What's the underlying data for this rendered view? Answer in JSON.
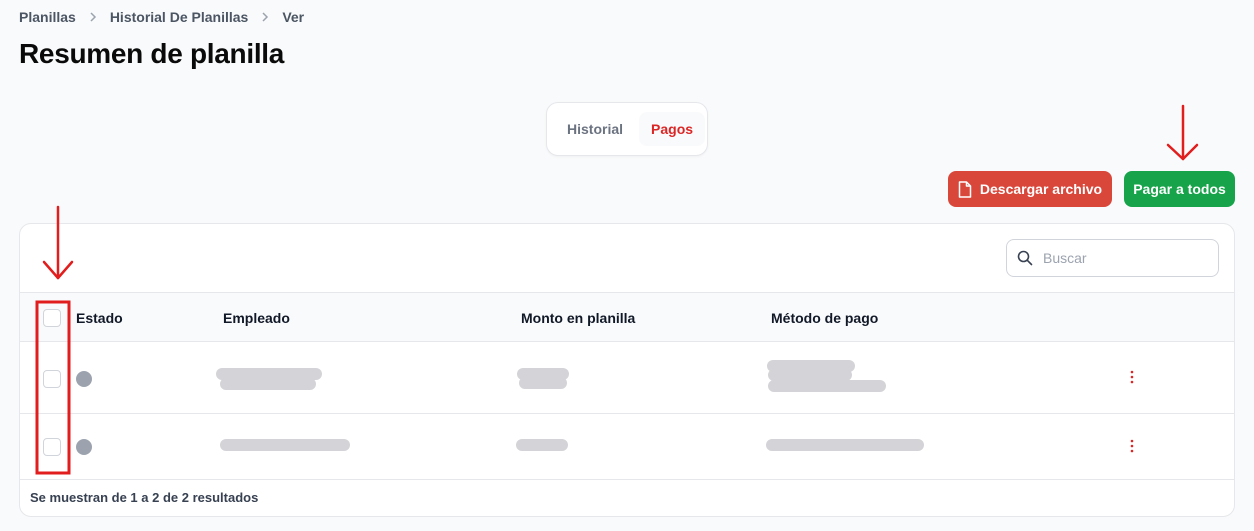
{
  "breadcrumb": [
    "Planillas",
    "Historial De Planillas",
    "Ver"
  ],
  "page_title": "Resumen de planilla",
  "tabs": [
    {
      "label": "Historial",
      "active": false
    },
    {
      "label": "Pagos",
      "active": true
    }
  ],
  "actions": {
    "download_label": "Descargar archivo",
    "pay_all_label": "Pagar a todos"
  },
  "search": {
    "placeholder": "Buscar"
  },
  "table": {
    "columns": [
      "Estado",
      "Empleado",
      "Monto en planilla",
      "Método de pago"
    ],
    "rows": [
      {
        "status": "gray"
      },
      {
        "status": "gray"
      }
    ]
  },
  "footer": "Se muestran de 1 a 2 de 2 resultados",
  "colors": {
    "primary_red": "#d9473a",
    "success_green": "#16a34a",
    "annotation_red": "#e11d1d"
  }
}
